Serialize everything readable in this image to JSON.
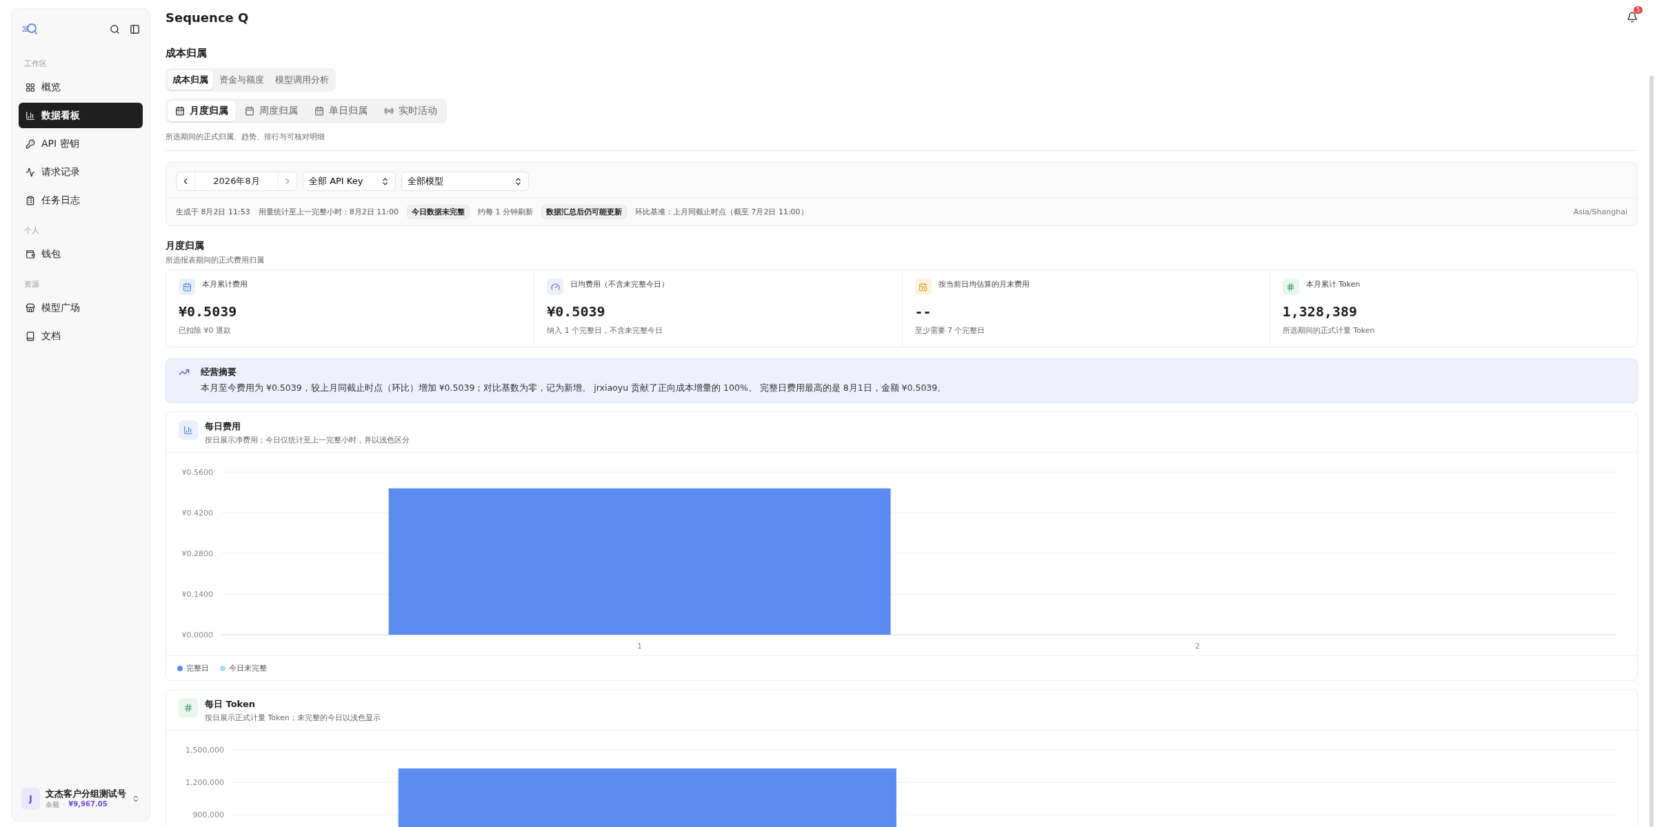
{
  "app": {
    "name": "Sequence Q",
    "notifications": "5"
  },
  "sidebar": {
    "sections": [
      {
        "label": "工作区",
        "items": [
          {
            "label": "概览",
            "kind": "grid",
            "selected": false
          },
          {
            "label": "数据看板",
            "kind": "chart",
            "selected": true
          },
          {
            "label": "API 密钥",
            "kind": "key",
            "selected": false
          },
          {
            "label": "请求记录",
            "kind": "activity",
            "selected": false
          },
          {
            "label": "任务日志",
            "kind": "clipboard",
            "selected": false
          }
        ]
      },
      {
        "label": "个人",
        "items": [
          {
            "label": "钱包",
            "kind": "wallet",
            "selected": false
          }
        ]
      },
      {
        "label": "资源",
        "items": [
          {
            "label": "模型广场",
            "kind": "store",
            "selected": false
          },
          {
            "label": "文档",
            "kind": "book",
            "selected": false
          }
        ]
      }
    ],
    "user": {
      "avatar": "J",
      "name": "文杰客户分组测试号",
      "balance_label": "余额",
      "separator": "·",
      "balance": "¥9,967.05"
    }
  },
  "page": {
    "title": "成本归属",
    "tabs": [
      {
        "label": "成本归属",
        "selected": true
      },
      {
        "label": "资金与额度",
        "selected": false
      },
      {
        "label": "模型调用分析",
        "selected": false
      }
    ],
    "subtabs": [
      {
        "label": "月度归属",
        "kind": "calendar-days",
        "selected": true
      },
      {
        "label": "周度归属",
        "kind": "calendar",
        "selected": false
      },
      {
        "label": "单日归属",
        "kind": "calendar-days",
        "selected": false
      },
      {
        "label": "实时活动",
        "kind": "radio",
        "selected": false
      }
    ],
    "description": "所选期间的正式归属、趋势、排行与可核对明细"
  },
  "filters": {
    "month": "2026年8月",
    "api_key": "全部 API Key",
    "model": "全部模型",
    "meta": [
      {
        "kind": "text",
        "text": "生成于 8月2日 11:53"
      },
      {
        "kind": "text",
        "text": "用量统计至上一完整小时：8月2日 11:00"
      },
      {
        "kind": "badge",
        "text": "今日数据未完整"
      },
      {
        "kind": "text",
        "text": "约每 1 分钟刷新"
      },
      {
        "kind": "badge",
        "text": "数据汇总后仍可能更新"
      },
      {
        "kind": "text",
        "text": "环比基准：上月同截止时点（截至 7月2日 11:00）"
      }
    ],
    "timezone": "Asia/Shanghai"
  },
  "section": {
    "title": "月度归属",
    "subtitle": "所选报表期间的正式费用归属"
  },
  "kpis": [
    {
      "kind": "calendar",
      "label": "本月累计费用",
      "value": "¥0.5039",
      "note": "已扣除 ¥0 退款"
    },
    {
      "kind": "gauge",
      "label": "日均费用（不含未完整今日）",
      "value": "¥0.5039",
      "note": "纳入 1 个完整日，不含未完整今日"
    },
    {
      "kind": "calendar-clock",
      "label": "按当前日均估算的月末费用",
      "value": "--",
      "note": "至少需要 7 个完整日"
    },
    {
      "kind": "hash",
      "label": "本月累计 Token",
      "value": "1,328,389",
      "note": "所选期间的正式计量 Token"
    }
  ],
  "summary": {
    "title": "经营摘要",
    "text": "本月至今费用为 ¥0.5039，较上月同截止时点（环比）增加 ¥0.5039；对比基数为零，记为新增。 jrxiaoyu 贡献了正向成本增量的 100%。 完整日费用最高的是 8月1日，金额 ¥0.5039。"
  },
  "charts": [
    {
      "kind": "chart",
      "title": "每日费用",
      "subtitle": "按日展示净费用；今日仅统计至上一完整小时，并以浅色区分",
      "chart_data": {
        "type": "bar",
        "grid": true,
        "categories": [
          "1",
          "2"
        ],
        "series": [
          {
            "name": "完整日",
            "color": "#5b8bef",
            "values": [
              0.5039,
              null
            ]
          },
          {
            "name": "今日未完整",
            "color": "#a6def0",
            "values": [
              null,
              null
            ]
          }
        ],
        "ylim": [
          0,
          0.56
        ],
        "yticks": [
          {
            "value": 0,
            "label": "¥0.0000"
          },
          {
            "value": 0.14,
            "label": "¥0.1400"
          },
          {
            "value": 0.28,
            "label": "¥0.2800"
          },
          {
            "value": 0.42,
            "label": "¥0.4200"
          },
          {
            "value": 0.56,
            "label": "¥0.5600"
          }
        ]
      }
    },
    {
      "kind": "hash",
      "title": "每日 Token",
      "subtitle": "按日展示正式计量 Token；未完整的今日以浅色显示",
      "chart_data": {
        "type": "bar",
        "grid": true,
        "values": [
          1328389
        ],
        "ylim": [
          0,
          1500000
        ],
        "yticks": [
          {
            "value": 900000,
            "label": "900,000"
          },
          {
            "value": 1200000,
            "label": "1,200,000"
          },
          {
            "value": 1500000,
            "label": "1,500,000"
          }
        ]
      }
    }
  ]
}
